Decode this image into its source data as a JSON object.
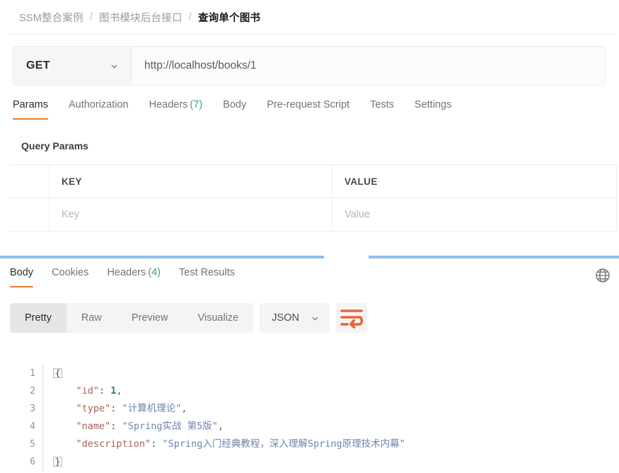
{
  "breadcrumb": {
    "items": [
      "SSM整合案例",
      "图书模块后台接口",
      "查询单个图书"
    ],
    "separator": "/"
  },
  "request": {
    "method": "GET",
    "url": "http://localhost/books/1",
    "tabs": [
      {
        "label": "Params",
        "active": true,
        "count": ""
      },
      {
        "label": "Authorization",
        "active": false,
        "count": ""
      },
      {
        "label": "Headers",
        "active": false,
        "count": "(7)"
      },
      {
        "label": "Body",
        "active": false,
        "count": ""
      },
      {
        "label": "Pre-request Script",
        "active": false,
        "count": ""
      },
      {
        "label": "Tests",
        "active": false,
        "count": ""
      },
      {
        "label": "Settings",
        "active": false,
        "count": ""
      }
    ],
    "query_params": {
      "title": "Query Params",
      "headers": {
        "key": "KEY",
        "value": "VALUE"
      },
      "placeholder_row": {
        "key": "Key",
        "value": "Value"
      }
    }
  },
  "response": {
    "tabs": [
      {
        "label": "Body",
        "active": true,
        "count": ""
      },
      {
        "label": "Cookies",
        "active": false,
        "count": ""
      },
      {
        "label": "Headers",
        "active": false,
        "count": "(4)"
      },
      {
        "label": "Test Results",
        "active": false,
        "count": ""
      }
    ],
    "view_modes": [
      {
        "label": "Pretty",
        "active": true
      },
      {
        "label": "Raw",
        "active": false
      },
      {
        "label": "Preview",
        "active": false
      },
      {
        "label": "Visualize",
        "active": false
      }
    ],
    "format": "JSON",
    "body_lines": [
      {
        "n": "1",
        "fold": "{",
        "indent": "",
        "content": ""
      },
      {
        "n": "2",
        "fold": "",
        "indent": "    ",
        "key": "\"id\"",
        "sep": ": ",
        "num": "1",
        "tail": ","
      },
      {
        "n": "3",
        "fold": "",
        "indent": "    ",
        "key": "\"type\"",
        "sep": ": ",
        "str": "\"计算机理论\"",
        "tail": ","
      },
      {
        "n": "4",
        "fold": "",
        "indent": "    ",
        "key": "\"name\"",
        "sep": ": ",
        "str": "\"Spring实战 第5版\"",
        "tail": ","
      },
      {
        "n": "5",
        "fold": "",
        "indent": "    ",
        "key": "\"description\"",
        "sep": ": ",
        "str": "\"Spring入门经典教程，深入理解Spring原理技术内幕\"",
        "tail": ""
      },
      {
        "n": "6",
        "fold": "}",
        "indent": "",
        "content": ""
      }
    ]
  },
  "colors": {
    "accent_orange": "#ef7c29",
    "count_green": "#3aa56a",
    "splitter_blue": "#91bfe8",
    "json_key": "#a8615a",
    "json_string": "#6f82ad",
    "json_number": "#2f7a72"
  }
}
